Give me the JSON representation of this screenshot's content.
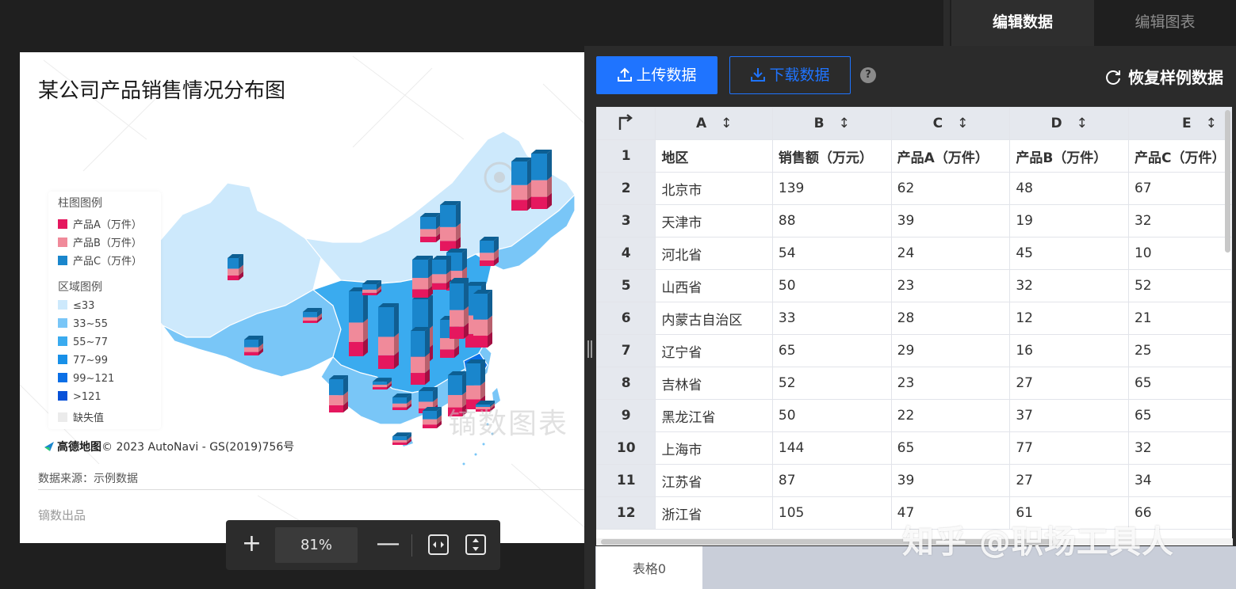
{
  "tabs": {
    "active": "编辑数据",
    "inactive": "编辑图表"
  },
  "chart": {
    "title": "某公司产品销售情况分布图",
    "bar_legend_title": "柱图图例",
    "bar_legend": [
      {
        "label": "产品A（万件）",
        "color": "#e5175e"
      },
      {
        "label": "产品B（万件）",
        "color": "#f08a9a"
      },
      {
        "label": "产品C（万件）",
        "color": "#1a86cc"
      }
    ],
    "region_legend_title": "区域图例",
    "region_legend": [
      {
        "label": "≤33",
        "color": "#cde9fc"
      },
      {
        "label": "33~55",
        "color": "#79c6f7"
      },
      {
        "label": "55~77",
        "color": "#3aabef"
      },
      {
        "label": "77~99",
        "color": "#1890e8"
      },
      {
        "label": "99~121",
        "color": "#0b6fe6"
      },
      {
        "label": ">121",
        "color": "#0851d8"
      },
      {
        "label": "缺失值",
        "color": "#ebebeb"
      }
    ],
    "map_brand": "高德地图",
    "map_copyright": "© 2023 AutoNavi - GS(2019)756号",
    "source": "数据来源：示例数据",
    "producer": "镝数出品",
    "watermark": "镝数图表"
  },
  "zoom": {
    "plus": "+",
    "percent": "81%",
    "minus": "—"
  },
  "toolbar": {
    "upload": "上传数据",
    "download": "下载数据",
    "help": "?",
    "restore": "恢复样例数据"
  },
  "sheet": {
    "columns": [
      "A",
      "B",
      "C",
      "D",
      "E"
    ],
    "rows": [
      {
        "n": "1",
        "cells": [
          "地区",
          "销售额（万元）",
          "产品A（万件）",
          "产品B（万件）",
          "产品C（万件）"
        ]
      },
      {
        "n": "2",
        "cells": [
          "北京市",
          "139",
          "62",
          "48",
          "67"
        ]
      },
      {
        "n": "3",
        "cells": [
          "天津市",
          "88",
          "39",
          "19",
          "32"
        ]
      },
      {
        "n": "4",
        "cells": [
          "河北省",
          "54",
          "24",
          "45",
          "10"
        ]
      },
      {
        "n": "5",
        "cells": [
          "山西省",
          "50",
          "23",
          "32",
          "52"
        ]
      },
      {
        "n": "6",
        "cells": [
          "内蒙古自治区",
          "33",
          "28",
          "12",
          "21"
        ]
      },
      {
        "n": "7",
        "cells": [
          "辽宁省",
          "65",
          "29",
          "16",
          "25"
        ]
      },
      {
        "n": "8",
        "cells": [
          "吉林省",
          "52",
          "23",
          "27",
          "65"
        ]
      },
      {
        "n": "9",
        "cells": [
          "黑龙江省",
          "50",
          "22",
          "37",
          "65"
        ]
      },
      {
        "n": "10",
        "cells": [
          "上海市",
          "144",
          "65",
          "77",
          "32"
        ]
      },
      {
        "n": "11",
        "cells": [
          "江苏省",
          "87",
          "39",
          "27",
          "34"
        ]
      },
      {
        "n": "12",
        "cells": [
          "浙江省",
          "105",
          "47",
          "61",
          "66"
        ]
      }
    ],
    "tab": "表格0"
  },
  "zh_watermark": "知乎 @职场工具人"
}
